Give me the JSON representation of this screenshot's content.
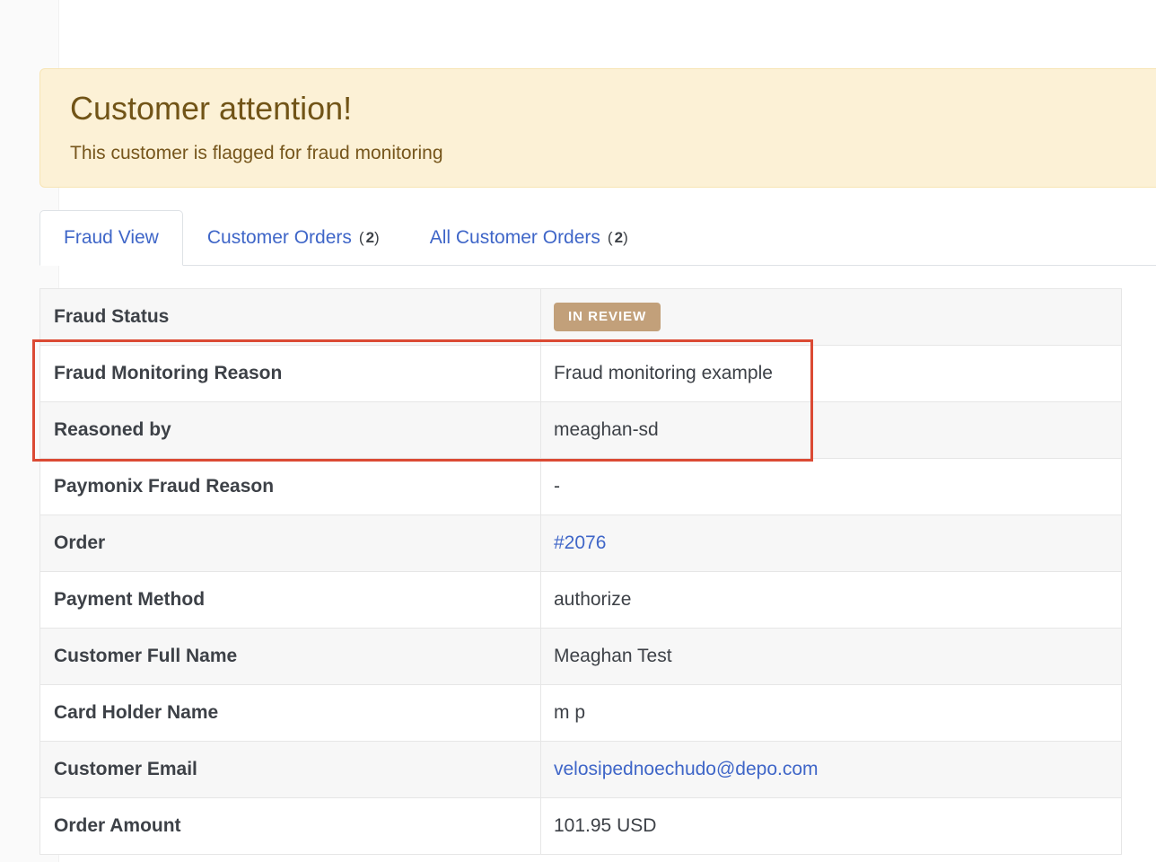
{
  "alert": {
    "title": "Customer attention!",
    "message": "This customer is flagged for fraud monitoring"
  },
  "tabs": [
    {
      "label": "Fraud View",
      "count": null,
      "active": true
    },
    {
      "label": "Customer Orders",
      "count": "2",
      "active": false
    },
    {
      "label": "All Customer Orders",
      "count": "2",
      "active": false
    }
  ],
  "details": {
    "fraud_status": {
      "label": "Fraud Status",
      "value": "IN REVIEW"
    },
    "fraud_monitoring_reason": {
      "label": "Fraud Monitoring Reason",
      "value": "Fraud monitoring example"
    },
    "reasoned_by": {
      "label": "Reasoned by",
      "value": "meaghan-sd"
    },
    "paymonix_fraud_reason": {
      "label": "Paymonix Fraud Reason",
      "value": "-"
    },
    "order": {
      "label": "Order",
      "value": "#2076"
    },
    "payment_method": {
      "label": "Payment Method",
      "value": "authorize"
    },
    "customer_full_name": {
      "label": "Customer Full Name",
      "value": "Meaghan Test"
    },
    "card_holder_name": {
      "label": "Card Holder Name",
      "value": "m p"
    },
    "customer_email": {
      "label": "Customer Email",
      "value": "velosipednoechudo@depo.com"
    },
    "order_amount": {
      "label": "Order Amount",
      "value": "101.95 USD"
    }
  },
  "colors": {
    "alert_bg": "#fcf1d6",
    "alert_text": "#76561c",
    "link": "#3f66c8",
    "badge": "#c2a07a",
    "highlight": "#db4a34"
  }
}
